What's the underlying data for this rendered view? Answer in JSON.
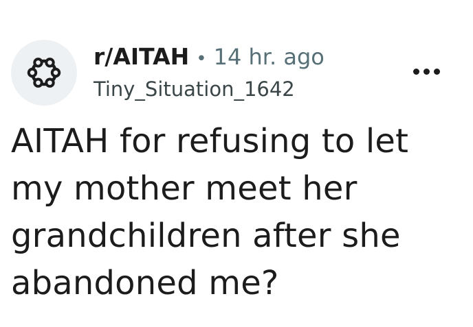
{
  "post": {
    "subreddit": "r/AITAH",
    "separator": "•",
    "time": "14 hr. ago",
    "author": "Tiny_Situation_1642",
    "title": "AITAH for refusing to let my mother meet her grandchildren after she abandoned me?"
  },
  "icons": {
    "avatar": "subreddit-community-icon",
    "more": "more-options-icon"
  },
  "colors": {
    "text": "#1c1c1c",
    "muted": "#576f76",
    "avatar_bg": "#eef1f3"
  }
}
